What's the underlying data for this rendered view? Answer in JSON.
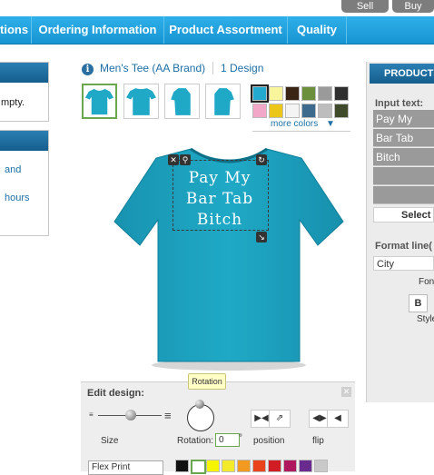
{
  "top_tabs": [
    "Sell",
    "Buy"
  ],
  "nav": {
    "items": [
      "tions",
      "Ordering Information",
      "Product Assortment",
      "Quality"
    ]
  },
  "left": {
    "panel1_text": "mpty.",
    "panel2_lines": [
      "and",
      "hours"
    ]
  },
  "product": {
    "title": "Men's Tee (AA Brand)",
    "designs": "1 Design",
    "more_colors": "more colors",
    "colors": [
      "#23a8d0",
      "#f9f59c",
      "#3a2414",
      "#6b8f3a",
      "#9a9a9a",
      "#2f2f2f",
      "#f2a7c8",
      "#ecc61a",
      "#f4f4f4",
      "#3d6b8e",
      "#bdbdbd",
      "#3e4a2a"
    ]
  },
  "design": {
    "lines": [
      "Pay My",
      "Bar Tab",
      "Bitch"
    ]
  },
  "edit": {
    "title": "Edit design:",
    "tooltip": "Rotation",
    "size_label": "Size",
    "rotation_label": "Rotation:",
    "rotation_value": "0",
    "degree": "°",
    "position_label": "position",
    "flip_label": "flip",
    "print_type": "Flex Print",
    "print_colors": [
      "#111111",
      "#ffffff",
      "#f7f400",
      "#f2ea2a",
      "#f29a1f",
      "#e8431a",
      "#d21c24",
      "#b0185e",
      "#6a2b8f",
      "#c9c9c9"
    ]
  },
  "right": {
    "header": "PRODUCTS",
    "input_label": "Input text:",
    "input_rows": [
      "Pay My",
      "Bar Tab",
      "Bitch",
      "",
      ""
    ],
    "select_label": "Select",
    "format_label": "Format line(",
    "city": "City",
    "font_label": "Font",
    "bold_label": "B",
    "style_label": "Style"
  },
  "shirt_color": "#1fa9c6"
}
